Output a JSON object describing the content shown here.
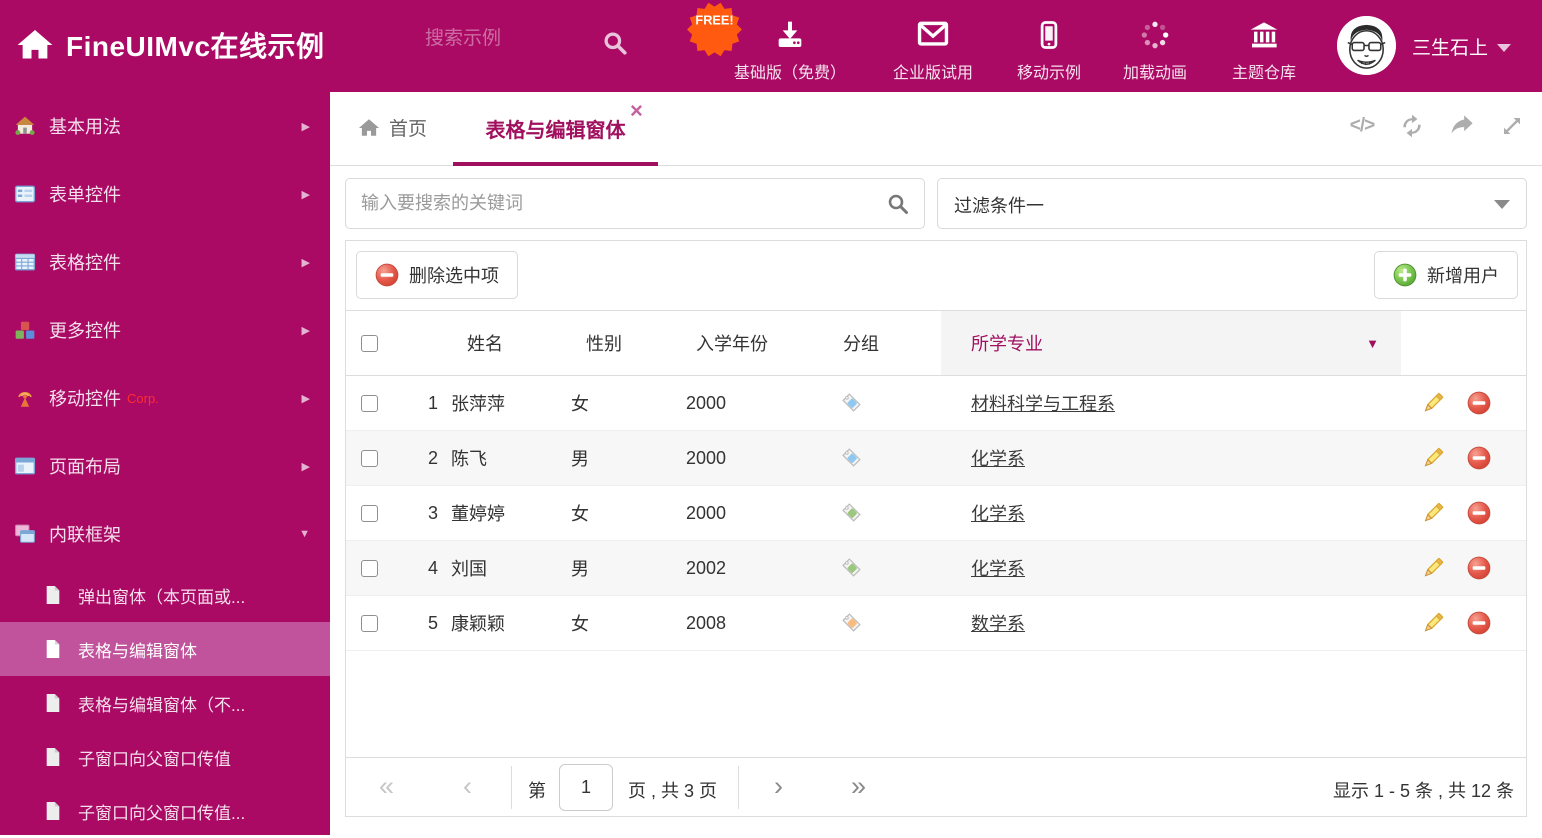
{
  "colors": {
    "brand": "#AA0A64",
    "brand_selected": "#C1539C",
    "accent": "#A0105F",
    "free_badge": "#FF5A0F",
    "tag_blue": "#8FC9F2",
    "tag_green": "#9CC77E",
    "tag_orange": "#F8BC82",
    "delete_red": "#E05045",
    "add_green": "#6EBE44"
  },
  "header": {
    "logo_text": "FineUIMvc在线示例",
    "search_placeholder": "搜索示例",
    "free_badge": "FREE!",
    "nav": [
      {
        "label": "基础版（免费）",
        "icon": "download-icon"
      },
      {
        "label": "企业版试用",
        "icon": "envelope-icon"
      },
      {
        "label": "移动示例",
        "icon": "mobile-icon"
      },
      {
        "label": "加载动画",
        "icon": "spinner-icon"
      },
      {
        "label": "主题仓库",
        "icon": "bank-icon"
      }
    ],
    "user_name": "三生石上"
  },
  "sidebar": {
    "items": [
      {
        "label": "基本用法",
        "icon": "home-icon"
      },
      {
        "label": "表单控件",
        "icon": "form-icon"
      },
      {
        "label": "表格控件",
        "icon": "grid-icon"
      },
      {
        "label": "更多控件",
        "icon": "cubes-icon"
      },
      {
        "label": "移动控件",
        "suffix": "Corp.",
        "icon": "antenna-icon"
      },
      {
        "label": "页面布局",
        "icon": "layout-icon"
      },
      {
        "label": "内联框架",
        "icon": "frames-icon",
        "expanded": true
      }
    ],
    "subitems": [
      {
        "label": "弹出窗体（本页面或..."
      },
      {
        "label": "表格与编辑窗体",
        "active": true
      },
      {
        "label": "表格与编辑窗体（不..."
      },
      {
        "label": "子窗口向父窗口传值"
      },
      {
        "label": "子窗口向父窗口传值..."
      }
    ]
  },
  "tabs": {
    "home_label": "首页",
    "active_label": "表格与编辑窗体"
  },
  "filters": {
    "search_placeholder": "输入要搜索的关键词",
    "filter_selected": "过滤条件一"
  },
  "grid": {
    "delete_button": "删除选中项",
    "add_button": "新增用户",
    "columns": {
      "name": "姓名",
      "gender": "性别",
      "year": "入学年份",
      "group": "分组",
      "major": "所学专业"
    },
    "rows": [
      {
        "num": "1",
        "name": "张萍萍",
        "gender": "女",
        "year": "2000",
        "tag": "blue",
        "major": "材料科学与工程系"
      },
      {
        "num": "2",
        "name": "陈飞",
        "gender": "男",
        "year": "2000",
        "tag": "blue",
        "major": "化学系"
      },
      {
        "num": "3",
        "name": "董婷婷",
        "gender": "女",
        "year": "2000",
        "tag": "green",
        "major": "化学系"
      },
      {
        "num": "4",
        "name": "刘国",
        "gender": "男",
        "year": "2002",
        "tag": "green",
        "major": "化学系"
      },
      {
        "num": "5",
        "name": "康颖颖",
        "gender": "女",
        "year": "2008",
        "tag": "orange",
        "major": "数学系"
      }
    ],
    "pager": {
      "first": "«",
      "prev": "‹",
      "page_prefix": "第",
      "page_value": "1",
      "page_suffix": "页 , 共 3 页",
      "next": "›",
      "last": "»",
      "summary": "显示 1 - 5 条 , 共 12 条"
    }
  }
}
